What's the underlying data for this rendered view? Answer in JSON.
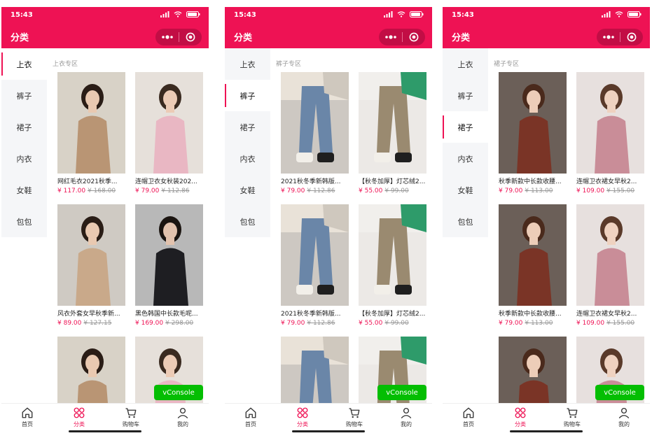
{
  "status": {
    "time": "15:43"
  },
  "header": {
    "title": "分类"
  },
  "sidebar": [
    "上衣",
    "裤子",
    "裙子",
    "内衣",
    "女鞋",
    "包包"
  ],
  "tabbar": [
    {
      "label": "首页",
      "icon": "home-icon"
    },
    {
      "label": "分类",
      "icon": "category-icon"
    },
    {
      "label": "购物车",
      "icon": "cart-icon"
    },
    {
      "label": "我的",
      "icon": "user-icon"
    }
  ],
  "vconsole": "vConsole",
  "colors": {
    "brand": "#ee1254",
    "vconsole": "#04be02"
  },
  "screens": [
    {
      "active": 0,
      "section": "上衣专区",
      "products": [
        {
          "title": "网红毛衣2021秋季...",
          "price": "¥ 117.00",
          "original": "¥ 168.00"
        },
        {
          "title": "连帽卫衣女秋装202...",
          "price": "¥ 79.00",
          "original": "¥ 112.86"
        },
        {
          "title": "风衣外套女早秋季新...",
          "price": "¥ 89.00",
          "original": "¥ 127.15"
        },
        {
          "title": "黑色韩国中长款毛呢...",
          "price": "¥ 169.00",
          "original": "¥ 298.00"
        },
        {
          "title": "",
          "price": "",
          "original": ""
        },
        {
          "title": "",
          "price": "",
          "original": ""
        }
      ]
    },
    {
      "active": 1,
      "section": "裤子专区",
      "products": [
        {
          "title": "2021秋冬季新韩版...",
          "price": "¥ 79.00",
          "original": "¥ 112.86"
        },
        {
          "title": "【秋冬加厚】灯芯绒2...",
          "price": "¥ 55.00",
          "original": "¥ 99.00"
        },
        {
          "title": "2021秋冬季新韩版...",
          "price": "¥ 79.00",
          "original": "¥ 112.86"
        },
        {
          "title": "【秋冬加厚】灯芯绒2...",
          "price": "¥ 55.00",
          "original": "¥ 99.00"
        },
        {
          "title": "",
          "price": "",
          "original": ""
        },
        {
          "title": "",
          "price": "",
          "original": ""
        }
      ]
    },
    {
      "active": 2,
      "section": "裙子专区",
      "products": [
        {
          "title": "秋季新款中长款收腰...",
          "price": "¥ 79.00",
          "original": "¥ 113.00"
        },
        {
          "title": "连帽卫衣裙女早秋2...",
          "price": "¥ 109.00",
          "original": "¥ 155.00"
        },
        {
          "title": "秋季新款中长款收腰...",
          "price": "¥ 79.00",
          "original": "¥ 113.00"
        },
        {
          "title": "连帽卫衣裙女早秋2...",
          "price": "¥ 109.00",
          "original": "¥ 155.00"
        },
        {
          "title": "",
          "price": "",
          "original": ""
        },
        {
          "title": "",
          "price": "",
          "original": ""
        }
      ]
    }
  ]
}
